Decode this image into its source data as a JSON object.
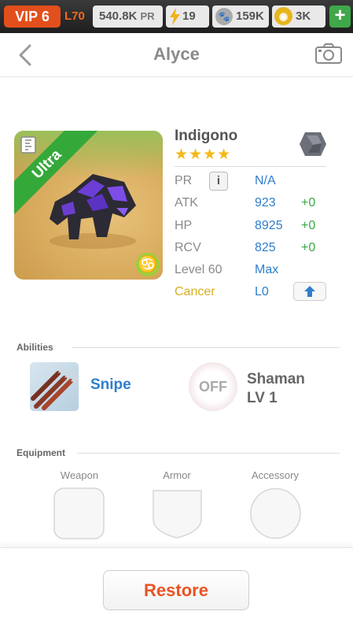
{
  "status_bar": {
    "vip": "VIP 6",
    "level": "L70",
    "pr_value": "540.8K",
    "pr_unit": "PR",
    "energy": "19",
    "paws": "159K",
    "coins": "3K",
    "add_icon": "plus-icon"
  },
  "header": {
    "title": "Alyce",
    "back_icon": "chevron-left-icon",
    "camera_icon": "camera-icon"
  },
  "monster": {
    "rarity": "Ultra",
    "name": "Indigono",
    "stars": "★★★★",
    "star_count": 4,
    "element_icon": "rock-element-icon",
    "zodiac_icon": "cancer-zodiac-icon",
    "stats": [
      {
        "key": "PR",
        "value": "N/A",
        "bonus": ""
      },
      {
        "key": "ATK",
        "value": "923",
        "bonus": "+0"
      },
      {
        "key": "HP",
        "value": "8925",
        "bonus": "+0"
      },
      {
        "key": "RCV",
        "value": "825",
        "bonus": "+0"
      },
      {
        "key": "Level 60",
        "value": "Max",
        "bonus": ""
      },
      {
        "key": "Cancer",
        "value": "L0",
        "bonus": ""
      }
    ],
    "info_label": "i"
  },
  "abilities": {
    "section_title": "Abilities",
    "primary": {
      "name": "Snipe",
      "icon": "arrows-icon"
    },
    "secondary": {
      "status": "OFF",
      "name": "Shaman",
      "level": "LV 1"
    }
  },
  "equipment": {
    "section_title": "Equipment",
    "slots": [
      "Weapon",
      "Armor",
      "Accessory"
    ]
  },
  "footer": {
    "restore_label": "Restore"
  },
  "colors": {
    "accent_orange": "#e34f1c",
    "stat_blue": "#2f7ecb",
    "bonus_green": "#3ba845",
    "gold": "#d6b020",
    "rarity_green": "#35a83a"
  }
}
